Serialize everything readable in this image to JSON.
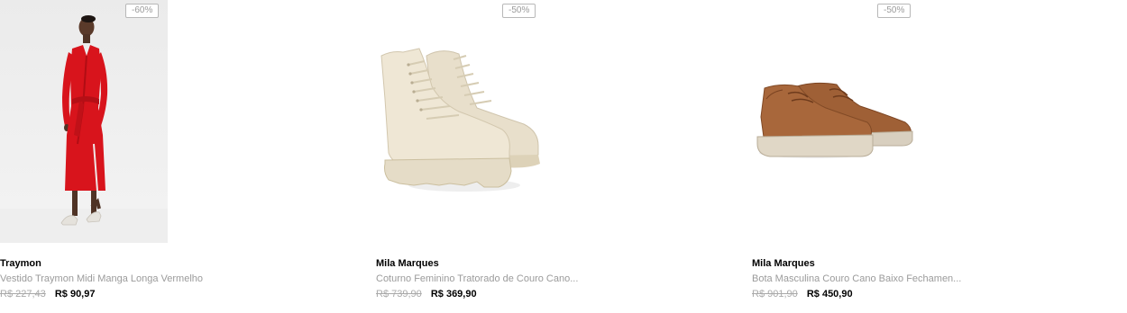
{
  "products": [
    {
      "discount": "-60%",
      "brand": "Traymon",
      "name": "Vestido Traymon Midi Manga Longa Vermelho",
      "old_price": "R$ 227,43",
      "price": "R$ 90,97",
      "image": "red-long-sleeve-midi-dress-photo"
    },
    {
      "discount": "-50%",
      "brand": "Mila Marques",
      "name": "Coturno Feminino Tratorado de Couro Cano...",
      "old_price": "R$ 739,90",
      "price": "R$ 369,90",
      "image": "cream-leather-combat-boots-photo"
    },
    {
      "discount": "-50%",
      "brand": "Mila Marques",
      "name": "Bota Masculina Couro Cano Baixo Fechamen...",
      "old_price": "R$ 901,90",
      "price": "R$ 450,90",
      "image": "brown-suede-chukka-shoes-photo"
    }
  ],
  "colors": {
    "dress_red": "#d8141c",
    "boot_cream": "#ece4d2",
    "shoe_brown": "#9a5b32"
  }
}
